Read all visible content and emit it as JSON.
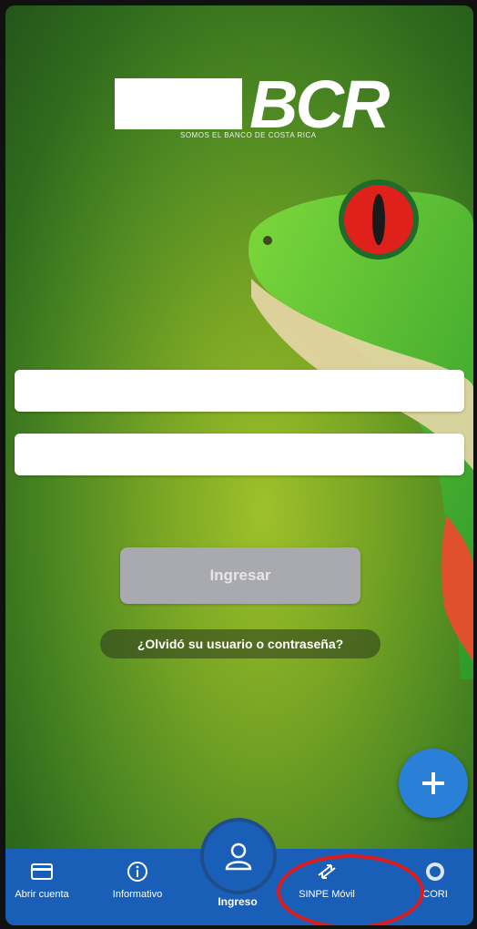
{
  "logo": {
    "brand": "BCR",
    "tagline": "SOMOS EL BANCO DE COSTA RICA"
  },
  "login": {
    "user_placeholder": "",
    "password_placeholder": "",
    "submit_label": "Ingresar",
    "forgot_label": "¿Olvidó su usuario o contraseña?"
  },
  "nav": {
    "items": [
      {
        "label": "Abrir cuenta",
        "icon": "card-icon"
      },
      {
        "label": "Informativo",
        "icon": "info-icon"
      },
      {
        "label": "Ingreso",
        "icon": "user-icon"
      },
      {
        "label": "SINPE Móvil",
        "icon": "sinpe-icon"
      },
      {
        "label": "CORI",
        "icon": "cori-icon"
      }
    ]
  },
  "colors": {
    "nav_bg": "#1a5fb7",
    "fab": "#2a7fd6",
    "login_button": "#a9aab0",
    "highlight": "#e01b1b"
  }
}
